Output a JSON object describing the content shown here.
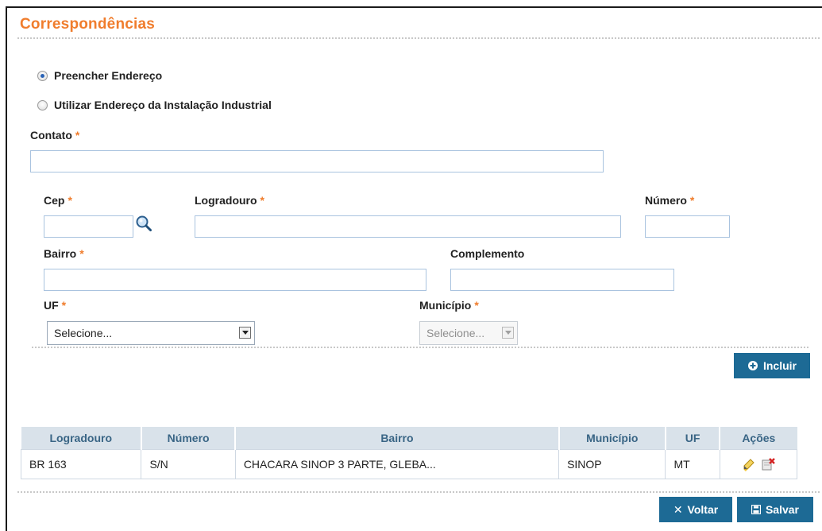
{
  "page_title": "Correspondências",
  "radio_options": [
    {
      "label": "Preencher Endereço",
      "selected": true
    },
    {
      "label": "Utilizar Endereço da Instalação Industrial",
      "selected": false
    }
  ],
  "required_mark": "*",
  "fields": {
    "contato": {
      "label": "Contato",
      "value": ""
    },
    "cep": {
      "label": "Cep",
      "value": ""
    },
    "logradouro": {
      "label": "Logradouro",
      "value": ""
    },
    "numero": {
      "label": "Número",
      "value": ""
    },
    "bairro": {
      "label": "Bairro",
      "value": ""
    },
    "complemento": {
      "label": "Complemento",
      "value": ""
    },
    "uf": {
      "label": "UF",
      "selected": "Selecione..."
    },
    "municipio": {
      "label": "Município",
      "selected": "Selecione..."
    }
  },
  "buttons": {
    "incluir": "Incluir",
    "voltar": "Voltar",
    "salvar": "Salvar"
  },
  "table": {
    "headers": [
      "Logradouro",
      "Número",
      "Bairro",
      "Município",
      "UF",
      "Ações"
    ],
    "rows": [
      {
        "logradouro": "BR 163",
        "numero": "S/N",
        "bairro": "CHACARA SINOP 3 PARTE, GLEBA...",
        "municipio": "SINOP",
        "uf": "MT"
      }
    ]
  },
  "colors": {
    "accent": "#f07d2d",
    "button": "#1d6a95",
    "header_bg": "#d9e2ea",
    "input_border": "#a9c3df"
  },
  "icons": [
    "search-icon",
    "plus-circle-icon",
    "close-icon",
    "save-icon",
    "edit-icon",
    "delete-icon"
  ]
}
